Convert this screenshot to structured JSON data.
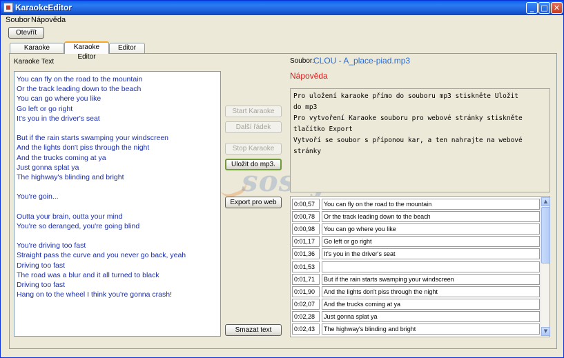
{
  "window": {
    "title": "KaraokeEditor"
  },
  "menu": [
    "Soubor",
    "Nápověda"
  ],
  "toolbar": {
    "open_label": "Otevřít"
  },
  "tabs": [
    {
      "label": "Karaoke přehrávač",
      "active": false
    },
    {
      "label": "Karaoke Editor",
      "active": true
    },
    {
      "label": "Editor Tagů",
      "active": false
    }
  ],
  "editor": {
    "text_label": "Karaoke Text",
    "file_label": "Soubor:",
    "file_name": "CLOU - A_place-piad.mp3",
    "help_link": "Nápověda",
    "help_text": [
      "Pro uložení karaoke přímo do souboru mp3 stiskněte Uložit",
      "do mp3",
      "Pro vytvoření Karaoke souboru pro webové stránky stiskněte",
      "tlačítko Export",
      "Vytvoří se soubor s příponou kar, a ten nahrajte na webové",
      "stránky"
    ],
    "buttons": {
      "start": "Start Karaoke",
      "next": "Další řádek",
      "stop": "Stop Karaoke",
      "save_mp3": "Uložit do mp3.",
      "export": "Export pro web",
      "clear": "Smazat text"
    },
    "lyrics": [
      "You can fly on the road to the mountain",
      "Or the track leading down to the beach",
      "You can go where you like",
      "Go left or go right",
      "It's you in the driver's seat",
      "",
      "But if the rain starts swamping your windscreen",
      "And the lights don't piss through the night",
      "And the trucks coming at ya",
      "Just gonna splat ya",
      "The highway's blinding and bright",
      "",
      "You're goin...",
      "",
      "Outta your brain, outta your mind",
      "You're so deranged, you're going blind",
      "",
      "You're driving too fast",
      "Straight pass the curve and you never go back, yeah",
      "Driving too fast",
      "The road was a blur and it all turned to black",
      "Driving too fast",
      "Hang on to the wheel I think you're gonna crash!"
    ],
    "timings": [
      {
        "time": "0:00,57",
        "text": "You can fly on the road to the mountain"
      },
      {
        "time": "0:00,78",
        "text": "Or the track leading down to the beach"
      },
      {
        "time": "0:00,98",
        "text": "You can go where you like"
      },
      {
        "time": "0:01,17",
        "text": "Go left or go right"
      },
      {
        "time": "0:01,36",
        "text": "It's you in the driver's seat"
      },
      {
        "time": "0:01,53",
        "text": ""
      },
      {
        "time": "0:01,71",
        "text": "But if the rain starts swamping your windscreen"
      },
      {
        "time": "0:01,90",
        "text": "And the lights don't piss through the night"
      },
      {
        "time": "0:02,07",
        "text": "And the trucks coming at ya"
      },
      {
        "time": "0:02,28",
        "text": "Just gonna splat ya"
      },
      {
        "time": "0:02,43",
        "text": "The highway's blinding and bright"
      }
    ]
  },
  "watermark": {
    "logo": "sosej",
    "tld": ".cz"
  },
  "colors": {
    "lyrics_text": "#1a2eab",
    "file_link": "#2a6cd6",
    "help_link": "#d41a1a"
  }
}
